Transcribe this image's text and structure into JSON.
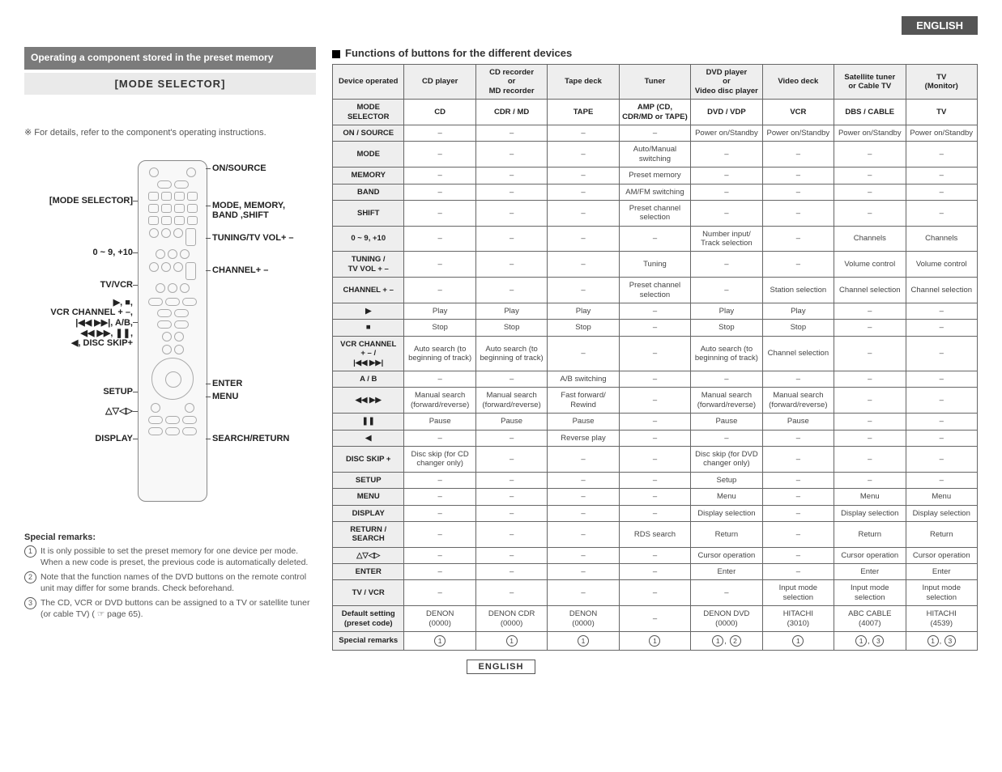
{
  "lang_top": "ENGLISH",
  "lang_bottom": "ENGLISH",
  "left": {
    "preset_header": "Operating a component stored in the preset memory",
    "mode_selector": "[MODE SELECTOR]",
    "details_note": "※ For details, refer to the component's operating instructions.",
    "callouts_right": {
      "on_source": "ON/SOURCE",
      "mode_mem": "MODE, MEMORY,\nBAND ,SHIFT",
      "tuning": "TUNING/TV VOL+ –",
      "channel": "CHANNEL+ –",
      "enter": "ENTER",
      "menu": "MENU",
      "search": "SEARCH/RETURN"
    },
    "callouts_left": {
      "mode_sel": "[MODE SELECTOR]",
      "digits": "0 ~ 9, +10",
      "tvvcr": "TV/VCR",
      "transport": "▶, ■,\nVCR CHANNEL + –,\n|◀◀ ▶▶|, A/B,\n◀◀ ▶▶, ❚❚,\n◀, DISC SKIP+",
      "setup": "SETUP",
      "nav": "△▽◁▷",
      "display": "DISPLAY"
    },
    "remarks_header": "Special remarks:",
    "remarks": [
      "It is only possible to set the preset memory for one device per mode. When a new code is preset, the previous code is automatically deleted.",
      "Note that the function names of the DVD buttons on the remote control unit may differ for some brands. Check beforehand.",
      "The CD, VCR or DVD buttons can be assigned to a TV or satellite tuner (or cable TV) ( ☞ page 65)."
    ]
  },
  "table": {
    "title": "Functions of buttons for the different devices",
    "head_row1": [
      "Device operated",
      "CD player",
      "CD recorder\nor\nMD recorder",
      "Tape deck",
      "Tuner",
      "DVD player\nor\nVideo disc player",
      "Video deck",
      "Satellite tuner\nor Cable TV",
      "TV\n(Monitor)"
    ],
    "rows": [
      [
        "MODE SELECTOR",
        "CD",
        "CDR / MD",
        "TAPE",
        "AMP (CD,\nCDR/MD or TAPE)",
        "DVD / VDP",
        "VCR",
        "DBS / CABLE",
        "TV"
      ],
      [
        "ON / SOURCE",
        "–",
        "–",
        "–",
        "–",
        "Power on/Standby",
        "Power on/Standby",
        "Power on/Standby",
        "Power on/Standby"
      ],
      [
        "MODE",
        "–",
        "–",
        "–",
        "Auto/Manual\nswitching",
        "–",
        "–",
        "–",
        "–"
      ],
      [
        "MEMORY",
        "–",
        "–",
        "–",
        "Preset memory",
        "–",
        "–",
        "–",
        "–"
      ],
      [
        "BAND",
        "–",
        "–",
        "–",
        "AM/FM switching",
        "–",
        "–",
        "–",
        "–"
      ],
      [
        "SHIFT",
        "–",
        "–",
        "–",
        "Preset channel\nselection",
        "–",
        "–",
        "–",
        "–"
      ],
      [
        "0 ~ 9, +10",
        "–",
        "–",
        "–",
        "–",
        "Number input/\nTrack selection",
        "–",
        "Channels",
        "Channels"
      ],
      [
        "TUNING /\nTV VOL + –",
        "–",
        "–",
        "–",
        "Tuning",
        "–",
        "–",
        "Volume control",
        "Volume control"
      ],
      [
        "CHANNEL + –",
        "–",
        "–",
        "–",
        "Preset channel\nselection",
        "–",
        "Station selection",
        "Channel selection",
        "Channel selection"
      ],
      [
        "▶",
        "Play",
        "Play",
        "Play",
        "–",
        "Play",
        "Play",
        "–",
        "–"
      ],
      [
        "■",
        "Stop",
        "Stop",
        "Stop",
        "–",
        "Stop",
        "Stop",
        "–",
        "–"
      ],
      [
        "VCR CHANNEL\n+ – /\n|◀◀ ▶▶|",
        "Auto search (to\nbeginning of track)",
        "Auto search (to\nbeginning of track)",
        "–",
        "–",
        "Auto search (to\nbeginning of track)",
        "Channel selection",
        "–",
        "–"
      ],
      [
        "A / B",
        "–",
        "–",
        "A/B switching",
        "–",
        "–",
        "–",
        "–",
        "–"
      ],
      [
        "◀◀ ▶▶",
        "Manual search\n(forward/reverse)",
        "Manual search\n(forward/reverse)",
        "Fast forward/\nRewind",
        "–",
        "Manual search\n(forward/reverse)",
        "Manual search\n(forward/reverse)",
        "–",
        "–"
      ],
      [
        "❚❚",
        "Pause",
        "Pause",
        "Pause",
        "–",
        "Pause",
        "Pause",
        "–",
        "–"
      ],
      [
        "◀",
        "–",
        "–",
        "Reverse play",
        "–",
        "–",
        "–",
        "–",
        "–"
      ],
      [
        "DISC SKIP +",
        "Disc skip (for CD\nchanger only)",
        "–",
        "–",
        "–",
        "Disc skip (for DVD\nchanger only)",
        "–",
        "–",
        "–"
      ],
      [
        "SETUP",
        "–",
        "–",
        "–",
        "–",
        "Setup",
        "–",
        "–",
        "–"
      ],
      [
        "MENU",
        "–",
        "–",
        "–",
        "–",
        "Menu",
        "–",
        "Menu",
        "Menu"
      ],
      [
        "DISPLAY",
        "–",
        "–",
        "–",
        "–",
        "Display selection",
        "–",
        "Display selection",
        "Display selection"
      ],
      [
        "RETURN /\nSEARCH",
        "–",
        "–",
        "–",
        "RDS search",
        "Return",
        "–",
        "Return",
        "Return"
      ],
      [
        "△▽◁▷",
        "–",
        "–",
        "–",
        "–",
        "Cursor operation",
        "–",
        "Cursor operation",
        "Cursor operation"
      ],
      [
        "ENTER",
        "–",
        "–",
        "–",
        "–",
        "Enter",
        "–",
        "Enter",
        "Enter"
      ],
      [
        "TV / VCR",
        "–",
        "–",
        "–",
        "–",
        "–",
        "Input mode\nselection",
        "Input mode\nselection",
        "Input mode\nselection"
      ],
      [
        "Default setting\n(preset code)",
        "DENON\n(0000)",
        "DENON CDR\n(0000)",
        "DENON\n(0000)",
        "–",
        "DENON DVD\n(0000)",
        "HITACHI\n(3010)",
        "ABC CABLE\n(4007)",
        "HITACHI\n(4539)"
      ],
      [
        "Special remarks",
        "①",
        "①",
        "①",
        "①",
        "①, ②",
        "①",
        "①, ③",
        "①, ③"
      ]
    ]
  }
}
